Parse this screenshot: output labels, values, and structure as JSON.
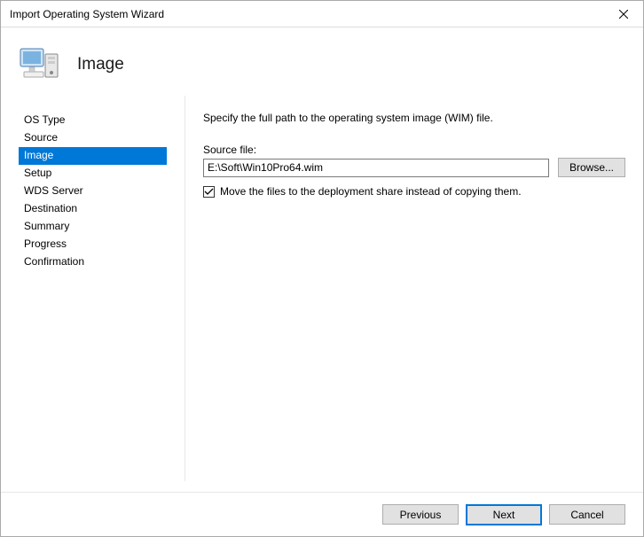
{
  "window": {
    "title": "Import Operating System Wizard"
  },
  "header": {
    "title": "Image"
  },
  "nav": {
    "items": [
      {
        "label": "OS Type"
      },
      {
        "label": "Source"
      },
      {
        "label": "Image"
      },
      {
        "label": "Setup"
      },
      {
        "label": "WDS Server"
      },
      {
        "label": "Destination"
      },
      {
        "label": "Summary"
      },
      {
        "label": "Progress"
      },
      {
        "label": "Confirmation"
      }
    ],
    "active_index": 2
  },
  "main": {
    "instruction": "Specify the full path to the operating system image (WIM) file.",
    "source_label": "Source file:",
    "source_value": "E:\\Soft\\Win10Pro64.wim",
    "browse_label": "Browse...",
    "move_files_checked": true,
    "move_files_label": "Move the files to the deployment share instead of copying them."
  },
  "footer": {
    "previous": "Previous",
    "next": "Next",
    "cancel": "Cancel"
  }
}
